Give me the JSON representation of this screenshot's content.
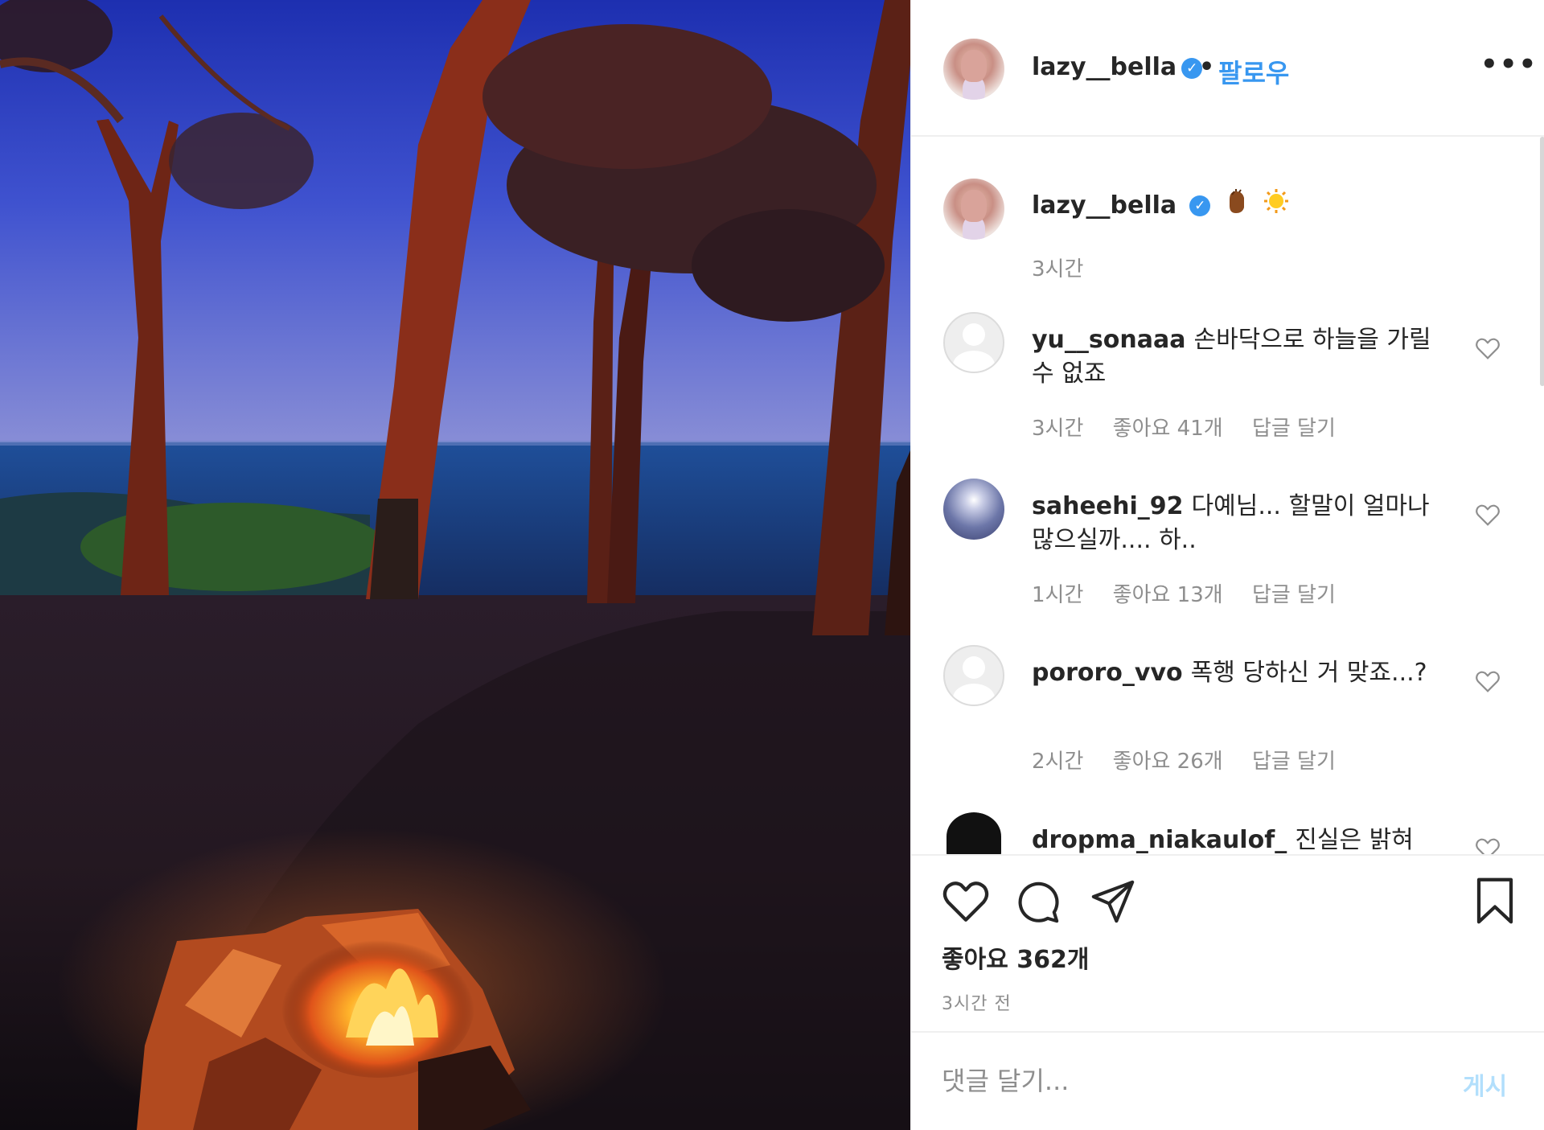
{
  "photo": {
    "alt": ""
  },
  "header": {
    "username": "lazy__bella",
    "verified_icon": "verified-badge-icon",
    "separator": "•",
    "follow_label": "팔로우",
    "more_icon": "more-options-icon",
    "more_label": "•••"
  },
  "caption": {
    "username": "lazy__bella",
    "emojis": [
      "hand-emoji",
      "sun-emoji"
    ],
    "time": "3시간"
  },
  "comments": [
    {
      "username": "yu__sonaaa",
      "text": "손바닥으로 하늘을 가릴 수 없죠",
      "time": "3시간",
      "likes": "좋아요 41개",
      "reply": "답글 달기"
    },
    {
      "username": "saheehi_92",
      "text": "다예님... 할말이 얼마나 많으실까.... 하..",
      "time": "1시간",
      "likes": "좋아요 13개",
      "reply": "답글 달기"
    },
    {
      "username": "pororo_vvo",
      "text": "폭행 당하신 거 맞죠...?",
      "time": "2시간",
      "likes": "좋아요 26개",
      "reply": "답글 달기"
    },
    {
      "username": "dropma_niakaulof_",
      "text": "진실은 밝혀",
      "time": "",
      "likes": "",
      "reply": ""
    }
  ],
  "actions": {
    "like_icon": "heart-icon",
    "comment_icon": "comment-icon",
    "share_icon": "send-icon",
    "save_icon": "bookmark-icon",
    "likes_label": "좋아요 362개",
    "time_label": "3시간 전"
  },
  "compose": {
    "placeholder": "댓글 달기...",
    "post_label": "게시"
  },
  "colors": {
    "accent": "#3897f0",
    "post_disabled": "#b2dffc",
    "muted": "#8e8e8e",
    "text": "#262626"
  }
}
